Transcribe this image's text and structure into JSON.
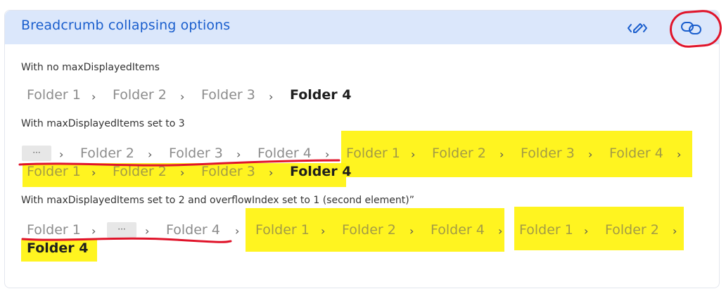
{
  "header": {
    "title": "Breadcrumb collapsing options",
    "edit_icon": "pen-code-icon",
    "link_icon": "link-icon"
  },
  "sections": [
    {
      "label": "With no maxDisplayedItems",
      "crumbs": [
        "Folder 1",
        "Folder 2",
        "Folder 3",
        "Folder 4"
      ]
    },
    {
      "label": "With maxDisplayedItems set to 3",
      "ellipsis": "···",
      "crumbs": [
        "Folder 2",
        "Folder 3",
        "Folder 4"
      ],
      "expanded": [
        "Folder 1",
        "Folder 2",
        "Folder 3",
        "Folder 4"
      ],
      "wrapped": [
        "Folder 1",
        "Folder 2",
        "Folder 3",
        "Folder 4"
      ]
    },
    {
      "label": "With maxDisplayedItems set to 2 and overflowIndex set to 1 (second element)”",
      "ellipsis": "···",
      "crumbs": [
        "Folder 1",
        "Folder 4"
      ],
      "expanded_a": [
        "Folder 1",
        "Folder 2",
        "Folder 4"
      ],
      "expanded_b": [
        "Folder 1",
        "Folder 2"
      ],
      "wrapped": [
        "Folder 4"
      ]
    }
  ],
  "separator": "›",
  "colors": {
    "accent": "#1a5ecd",
    "highlight": "#fff30d",
    "annotation": "#e0142a"
  }
}
